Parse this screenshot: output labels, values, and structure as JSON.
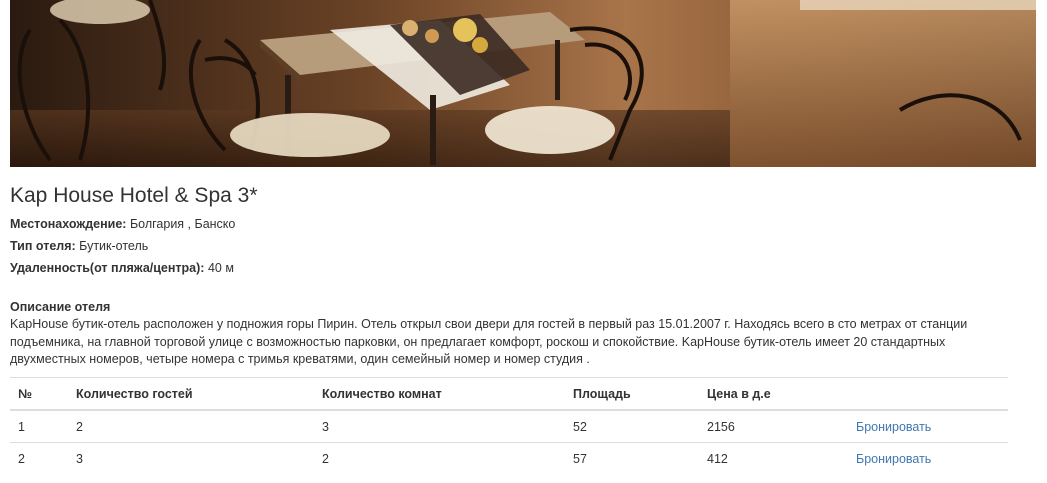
{
  "hotel": {
    "title": "Kap House Hotel & Spa 3*",
    "location_label": "Местонахождение:",
    "location_value": "Болгария , Банско",
    "type_label": "Тип отеля:",
    "type_value": "Бутик-отель",
    "distance_label": "Удаленность(от пляжа/центра):",
    "distance_value": "40 м"
  },
  "description": {
    "heading": "Описание отеля",
    "text": "KapHouse бутик-отель расположен у подножия горы Пирин. Отель открыл свои двери для гостей в первый раз 15.01.2007 г. Находясь всего в сто метрах от станции подъемника, на главной торговой улице с возможностью парковки, он предлагает комфорт, роскош и спокойствие. KapHouse бутик-отель имеет 20 стандартных двухместных номеров, четыре номера с тримья креватями, один семейный номер и номер студия ."
  },
  "rooms_table": {
    "headers": {
      "num": "№",
      "guests": "Количество гостей",
      "rooms": "Количество комнат",
      "area": "Площадь",
      "price": "Цена в д.е",
      "action": ""
    },
    "rows": [
      {
        "num": "1",
        "guests": "2",
        "rooms": "3",
        "area": "52",
        "price": "2156",
        "action": "Бронировать"
      },
      {
        "num": "2",
        "guests": "3",
        "rooms": "2",
        "area": "57",
        "price": "412",
        "action": "Бронировать"
      }
    ]
  },
  "colors": {
    "link": "#3f77b3",
    "text": "#333333",
    "border": "#dddddd"
  }
}
